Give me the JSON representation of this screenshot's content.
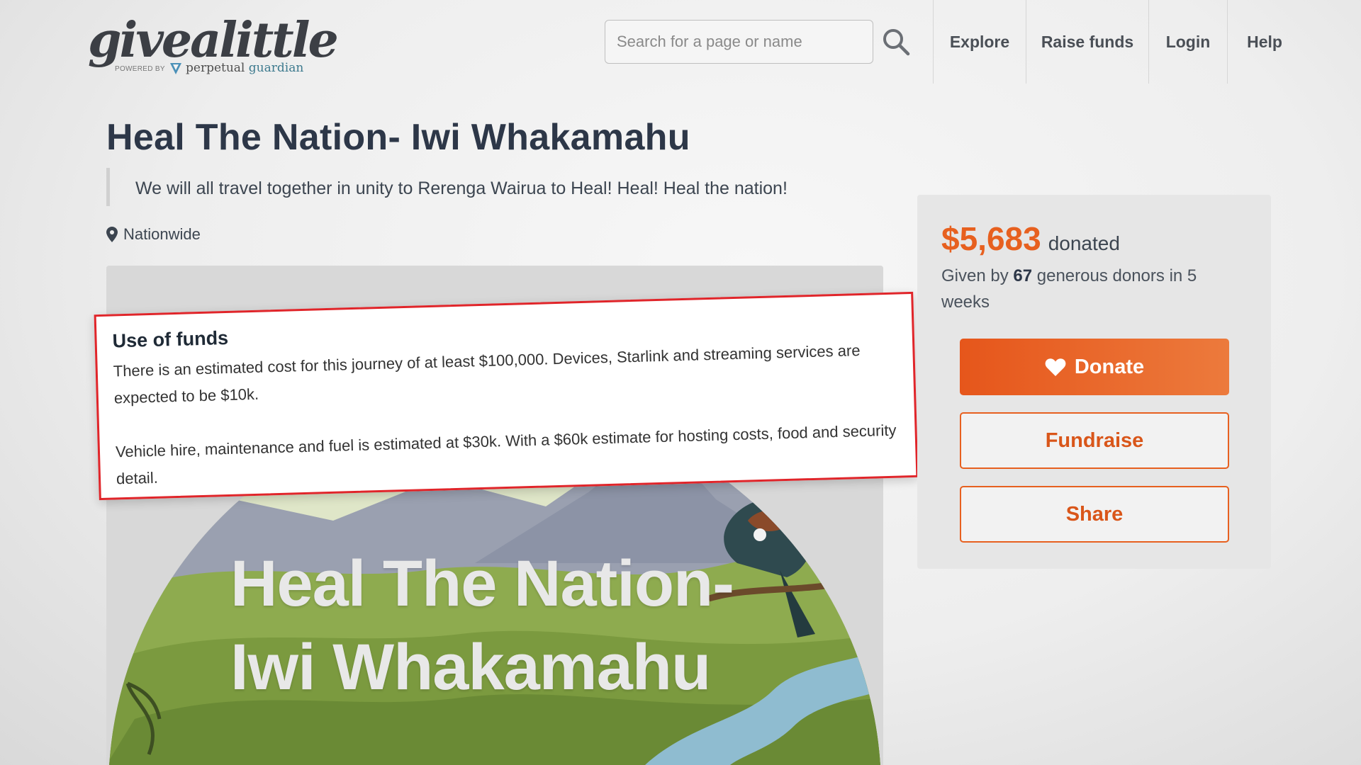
{
  "header": {
    "logo_word": "givealittle",
    "logo_powered": "POWERED BY",
    "logo_partner_a": "perpetual",
    "logo_partner_b": "guardian",
    "search_placeholder": "Search for a page or name",
    "nav": [
      "Explore",
      "Raise funds",
      "Login",
      "Help"
    ]
  },
  "page": {
    "title": "Heal The Nation- Iwi Whakamahu",
    "tagline": "We will all travel together in unity to Rerenga Wairua to Heal! Heal! Heal the nation!",
    "location": "Nationwide",
    "image_text_line1": "Heal The Nation-",
    "image_text_line2": "Iwi Whakamahu"
  },
  "use_of_funds": {
    "heading": "Use of funds",
    "paragraph1": "There is an estimated cost for this journey of at least $100,000. Devices, Starlink and streaming services are expected to be $10k.",
    "paragraph2": "Vehicle hire, maintenance and fuel is estimated at $30k. With a $60k estimate for hosting costs, food and security detail."
  },
  "donation": {
    "amount": "$5,683",
    "amount_label": "donated",
    "given_prefix": "Given by",
    "donor_count": "67",
    "given_suffix": "generous donors in 5 weeks",
    "donate_label": "Donate",
    "fundraise_label": "Fundraise",
    "share_label": "Share"
  },
  "colors": {
    "accent": "#e7601f",
    "callout_border": "#e0252a",
    "title": "#2d3748"
  }
}
